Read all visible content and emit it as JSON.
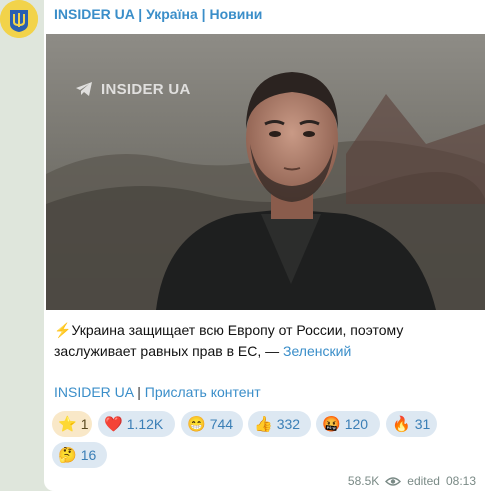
{
  "channel": {
    "title": "INSIDER UA | Україна | Новини"
  },
  "photo": {
    "watermark": "INSIDER UA"
  },
  "post": {
    "bolt": "⚡",
    "text": "Украина защищает всю Европу от России, поэтому заслуживает равных прав в ЕС, — ",
    "quote_link": "Зеленский"
  },
  "footer": {
    "channel_link": "INSIDER UA",
    "separator": " | ",
    "submit_link": "Прислать контент"
  },
  "reactions": [
    {
      "emoji": "⭐",
      "count": "1"
    },
    {
      "emoji": "❤️",
      "count": "1.12K"
    },
    {
      "emoji": "😁",
      "count": "744"
    },
    {
      "emoji": "👍",
      "count": "332"
    },
    {
      "emoji": "🤬",
      "count": "120"
    },
    {
      "emoji": "🔥",
      "count": "31"
    },
    {
      "emoji": "🤔",
      "count": "16"
    }
  ],
  "meta": {
    "views": "58.5K",
    "edited": "edited",
    "time": "08:13"
  },
  "colors": {
    "link": "#3a8ec9",
    "reaction_bg": "#dde8f2",
    "page_bg": "#dfe6dc"
  }
}
